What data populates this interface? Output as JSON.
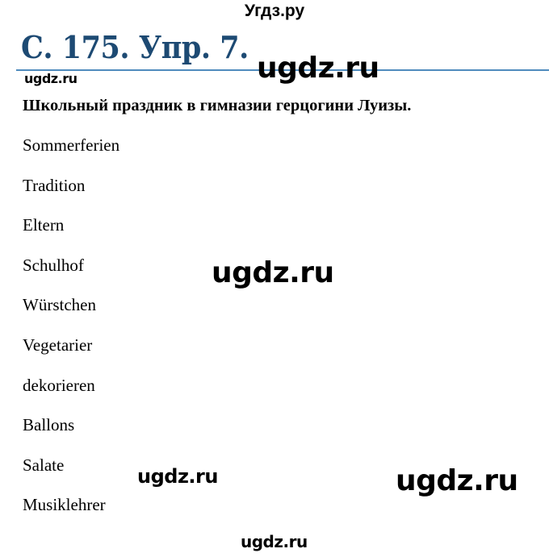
{
  "header": {
    "site_name": "Угдз.ру"
  },
  "page": {
    "title": "С. 175. Упр. 7.",
    "title_color": "#1d4a73",
    "rule_color": "#4f8bbd",
    "subtitle": "Школьный праздник в гимназии герцогини Луизы.",
    "words": [
      "Sommerferien",
      "Tradition",
      "Eltern",
      "Schulhof",
      "Würstchen",
      "Vegetarier",
      "dekorieren",
      "Ballons",
      "Salate",
      "Musiklehrer"
    ]
  },
  "watermarks": {
    "small_top": "ugdz.ru",
    "large_top": "ugdz.ru",
    "mid": "ugdz.ru",
    "lower_left": "ugdz.ru",
    "lower_right": "ugdz.ru",
    "bottom": "ugdz.ru"
  }
}
